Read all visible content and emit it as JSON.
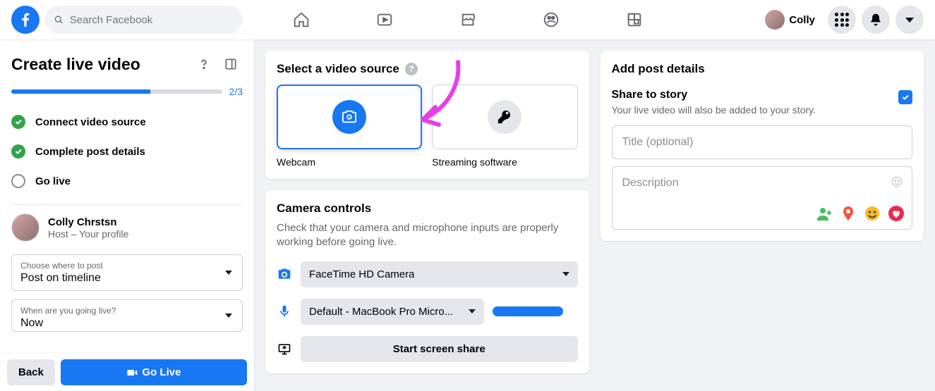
{
  "header": {
    "search_placeholder": "Search Facebook",
    "profile_name": "Colly"
  },
  "sidebar": {
    "title": "Create live video",
    "progress_text": "2/3",
    "progress_percent": 66,
    "steps": [
      {
        "label": "Connect video source",
        "done": true
      },
      {
        "label": "Complete post details",
        "done": true
      },
      {
        "label": "Go live",
        "done": false
      }
    ],
    "host": {
      "name": "Colly Chrstsn",
      "sub": "Host – Your profile"
    },
    "post_select": {
      "label": "Choose where to post",
      "value": "Post on timeline"
    },
    "when_select": {
      "label": "When are you going live?",
      "value": "Now"
    },
    "back_label": "Back",
    "golive_label": "Go Live"
  },
  "source_card": {
    "title": "Select a video source",
    "options": [
      {
        "label": "Webcam",
        "selected": true
      },
      {
        "label": "Streaming software",
        "selected": false
      }
    ]
  },
  "camera_card": {
    "title": "Camera controls",
    "sub": "Check that your camera and microphone inputs are properly working before going live.",
    "camera_value": "FaceTime HD Camera",
    "mic_value": "Default - MacBook Pro Micro...",
    "screen_share_label": "Start screen share"
  },
  "details_card": {
    "title": "Add post details",
    "story_title": "Share to story",
    "story_sub": "Your live video will also be added to your story.",
    "story_checked": true,
    "title_placeholder": "Title (optional)",
    "desc_placeholder": "Description"
  }
}
